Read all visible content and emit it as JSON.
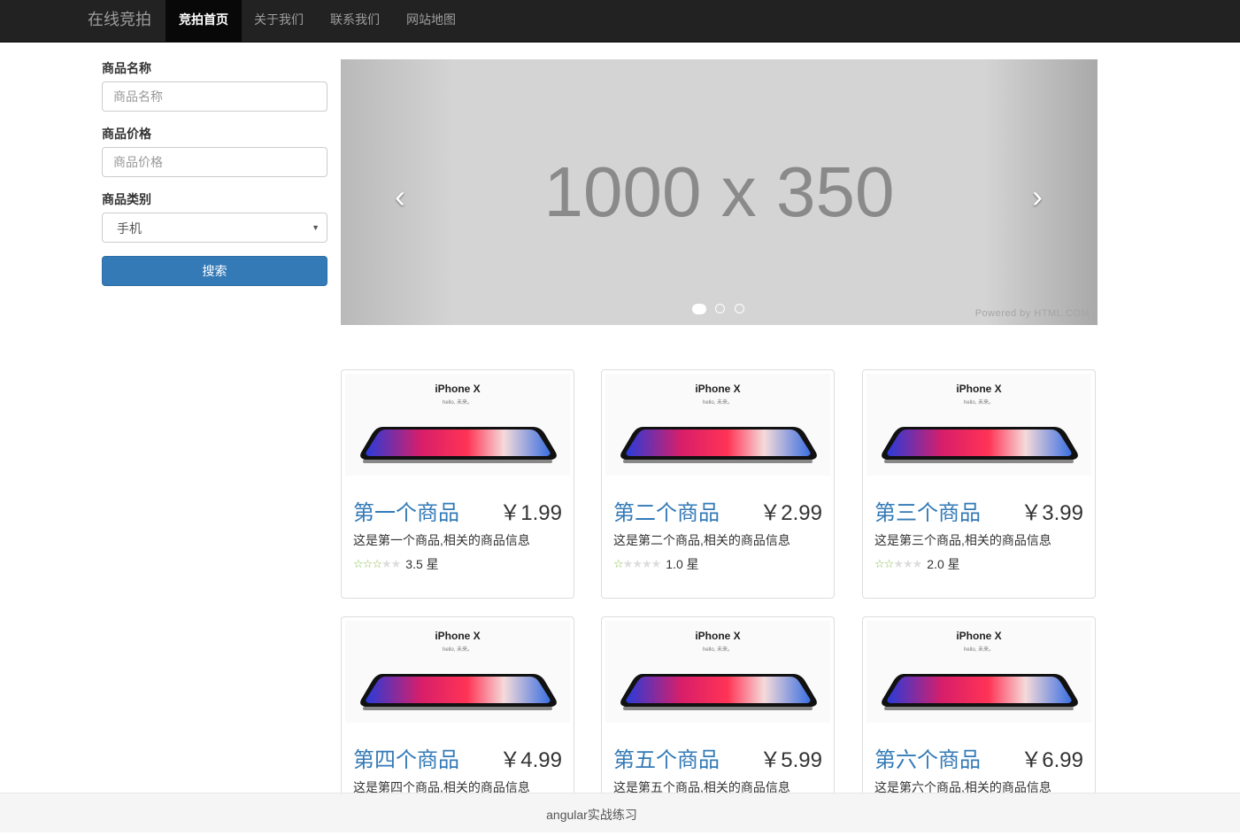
{
  "navbar": {
    "brand": "在线竞拍",
    "items": [
      "竞拍首页",
      "关于我们",
      "联系我们",
      "网站地图"
    ]
  },
  "search": {
    "name_label": "商品名称",
    "name_placeholder": "商品名称",
    "price_label": "商品价格",
    "price_placeholder": "商品价格",
    "category_label": "商品类别",
    "category_value": "手机",
    "button": "搜索"
  },
  "carousel": {
    "text": "1000 x 350",
    "powered": "Powered by HTML.COM",
    "slides": 3,
    "active_slide": 0
  },
  "products": [
    {
      "name": "第一个商品",
      "price": "￥1.99",
      "desc": "这是第一个商品,相关的商品信息",
      "rating": 3.5,
      "rating_text": "3.5 星",
      "thumb_title": "iPhone X",
      "thumb_sub": "hello, 未来。"
    },
    {
      "name": "第二个商品",
      "price": "￥2.99",
      "desc": "这是第二个商品,相关的商品信息",
      "rating": 1.0,
      "rating_text": "1.0 星",
      "thumb_title": "iPhone X",
      "thumb_sub": "hello, 未来。"
    },
    {
      "name": "第三个商品",
      "price": "￥3.99",
      "desc": "这是第三个商品,相关的商品信息",
      "rating": 2.0,
      "rating_text": "2.0 星",
      "thumb_title": "iPhone X",
      "thumb_sub": "hello, 未来。"
    },
    {
      "name": "第四个商品",
      "price": "￥4.99",
      "desc": "这是第四个商品,相关的商品信息",
      "thumb_title": "iPhone X",
      "thumb_sub": "hello, 未来。"
    },
    {
      "name": "第五个商品",
      "price": "￥5.99",
      "desc": "这是第五个商品,相关的商品信息",
      "thumb_title": "iPhone X",
      "thumb_sub": "hello, 未来。"
    },
    {
      "name": "第六个商品",
      "price": "￥6.99",
      "desc": "这是第六个商品,相关的商品信息",
      "thumb_title": "iPhone X",
      "thumb_sub": "hello, 未来。"
    }
  ],
  "footer": "angular实战练习",
  "colors": {
    "accent": "#337ab7",
    "navbar": "#222222",
    "star": "#8cc152"
  }
}
